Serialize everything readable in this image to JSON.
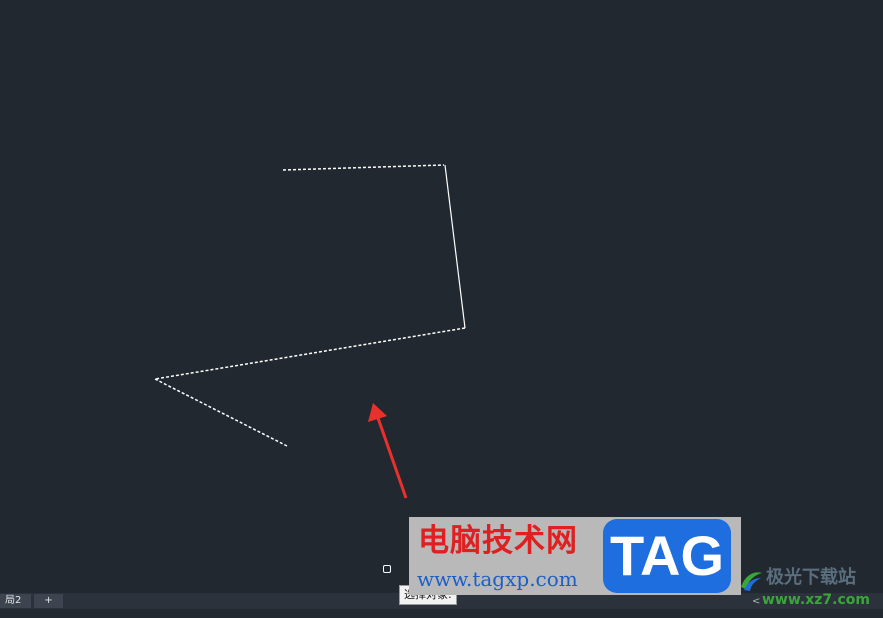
{
  "layout_tabs": {
    "layout2_label": "局2",
    "add_label": "+"
  },
  "statusbar": {
    "scroll_left_label": "<"
  },
  "cursor_prompt": {
    "text": "选择对象:"
  },
  "drawing": {
    "background": "#212830",
    "stroke_color": "#ffffff",
    "annotation_arrow_color": "#e8312a"
  },
  "watermark": {
    "title": "电脑技术网",
    "url": "www.tagxp.com",
    "badge": "TAG",
    "site2_title": "极光下载站",
    "site2_url": "www.xz7.com"
  }
}
